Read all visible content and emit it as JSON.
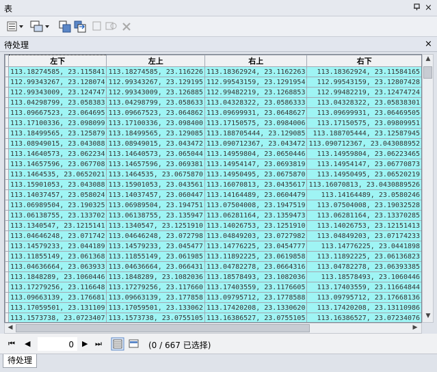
{
  "window": {
    "title": "表",
    "pin_icon": "pin-icon",
    "close_label": "×"
  },
  "toolbar": {
    "icons": [
      "table-options-icon",
      "related-tables-icon",
      "select-by-attributes-icon",
      "switch-selection-icon",
      "clear-selection-icon",
      "zoom-to-selected-icon",
      "delete-selected-icon"
    ]
  },
  "tab": {
    "label": "待处理",
    "close_label": "×"
  },
  "table": {
    "columns": [
      "左下",
      "左上",
      "右上",
      "右下"
    ],
    "rows": [
      [
        "113.18274585, 23.115841",
        "113.18274585, 23.116226",
        "113.18362924, 23.1162263",
        "113.18362924, 23.11584165"
      ],
      [
        "112.99343267, 23.128074",
        "112.99343267, 23.129195",
        "112.99543159, 23.1291954",
        "112.99543159, 23.12807428"
      ],
      [
        "112.99343009, 23.124747",
        "112.99343009, 23.126885",
        "112.99482219, 23.1268853",
        "112.99482219, 23.12474724"
      ],
      [
        "113.04298799, 23.058383",
        "113.04298799, 23.058633",
        "113.04328322, 23.0586333",
        "113.04328322, 23.05838301"
      ],
      [
        "113.09667523, 23.064695",
        "113.09667523, 23.064862",
        "113.09699931, 23.0648627",
        "113.09699931, 23.06469505"
      ],
      [
        "113.17100336, 23.098099",
        "113.17100336, 23.098400",
        "113.17150575, 23.0984006",
        "113.17150575, 23.09809951"
      ],
      [
        "113.18499565, 23.125879",
        "113.18499565, 23.129085",
        "113.188705444, 23.129085",
        "113.188705444, 23.12587945"
      ],
      [
        "113.08949015, 23.043088",
        "113.08949015, 23.043472",
        "113.090712367, 23.043472",
        "113.090712367, 23.043088952"
      ],
      [
        "113.14640573, 23.062234",
        "113.14640573, 23.065044",
        "113.14959804, 23.0650446",
        "113.14959804, 23.06223465"
      ],
      [
        "113.14657596, 23.067708",
        "113.14657596, 23.069381",
        "113.14954147, 23.0693819",
        "113.14954147, 23.06770873"
      ],
      [
        "113.1464535, 23.0652021",
        "113.1464535, 23.0675870",
        "113.14950495, 23.0675870",
        "113.14950495, 23.06520219"
      ],
      [
        "113.15901053, 23.043088",
        "113.15901053, 23.043561",
        "113.16070813, 23.0435617",
        "113.16070813, 23.0430889526"
      ],
      [
        "113.14037457, 23.058024",
        "113.14037457, 23.060447",
        "113.14164489, 23.0604479",
        "113.14164489, 23.0580246"
      ],
      [
        "113.06989504, 23.190325",
        "113.06989504, 23.194751",
        "113.07504008, 23.1947519",
        "113.07504008, 23.19032528"
      ],
      [
        "113.06138755, 23.133702",
        "113.06138755, 23.135947",
        "113.06281164, 23.1359473",
        "113.06281164, 23.13370285"
      ],
      [
        "113.1340547, 23.1215141",
        "113.1340547, 23.1251910",
        "113.14026753, 23.1251910",
        "113.14026753, 23.12151413"
      ],
      [
        "113.04646248, 23.071742",
        "113.04646248, 23.072798",
        "113.04849203, 23.0727982",
        "113.04849203, 23.07174233"
      ],
      [
        "113.14579233, 23.044189",
        "113.14579233, 23.045477",
        "113.14776225, 23.0454777",
        "113.14776225, 23.0441898"
      ],
      [
        "113.11855149, 23.061368",
        "113.11855149, 23.061985",
        "113.11892225, 23.0619858",
        "113.11892225, 23.06136823"
      ],
      [
        "113.04636664, 23.063933",
        "113.04636664, 23.066431",
        "113.04782278, 23.0664316",
        "113.04782278, 23.06393385"
      ],
      [
        "113.1848289, 23.1060446",
        "113.1848289, 23.1082036",
        "113.18578493, 23.1082036",
        "113.18578493, 23.1060446"
      ],
      [
        "113.17279256, 23.116648",
        "113.17279256, 23.117660",
        "113.17403559, 23.1176605",
        "113.17403559, 23.11664844"
      ],
      [
        "113.09663139, 23.176681",
        "113.09663139, 23.177858",
        "113.09795712, 23.1778588",
        "113.09795712, 23.17668136"
      ],
      [
        "113.17059501, 23.131109",
        "113.17059501, 23.133062",
        "113.17420208, 23.1330620",
        "113.17420208, 23.13110986"
      ],
      [
        "113.1573738, 23.0723407",
        "113.1573738, 23.0755105",
        "113.16386527, 23.0755105",
        "113.16386527, 23.07234076"
      ]
    ]
  },
  "nav": {
    "first": "⏮",
    "prev": "◀",
    "record": "0",
    "next": "▶",
    "last": "⏭",
    "count_text": "(0 / 667 已选择)"
  },
  "bottom_tab": {
    "label": "待处理"
  }
}
